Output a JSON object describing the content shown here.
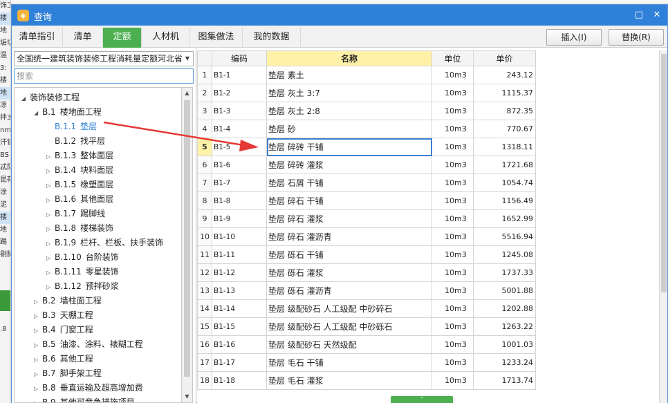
{
  "background_app": {
    "left_fragments": [
      "饰工",
      "楼",
      "地",
      "垢切",
      "混",
      "3:",
      "楼",
      "地",
      "凉",
      "拌3",
      "nm,",
      "汗铺",
      "BS",
      "忒防",
      "昆荷",
      "涂",
      "泥",
      "楼",
      "地",
      "踢",
      "剔脚",
      "",
      "",
      "",
      "工",
      "",
      ".8"
    ]
  },
  "dialog": {
    "title": "查询",
    "icon_glyph": "◈",
    "controls": {
      "maximize": "□",
      "close": "✕"
    }
  },
  "tabs": [
    {
      "label": "清单指引",
      "active": false
    },
    {
      "label": "清单",
      "active": false
    },
    {
      "label": "定额",
      "active": true
    },
    {
      "label": "人材机",
      "active": false
    },
    {
      "label": "图集做法",
      "active": false
    },
    {
      "label": "我的数据",
      "active": false
    }
  ],
  "toolbar": {
    "insert_label": "插入(I)",
    "replace_label": "替换(R)"
  },
  "left": {
    "quota_library": "全国统一建筑装饰装修工程消耗量定额河北省",
    "search_placeholder": "搜索",
    "tree": [
      {
        "tri": "◢",
        "code": "",
        "label": "装饰装修工程",
        "level": 0,
        "selected": false
      },
      {
        "tri": "◢",
        "code": "B.1",
        "label": "楼地面工程",
        "level": 1,
        "selected": false
      },
      {
        "tri": "",
        "code": "B.1.1",
        "label": "垫层",
        "level": 2,
        "selected": true
      },
      {
        "tri": "",
        "code": "B.1.2",
        "label": "找平层",
        "level": 2,
        "selected": false
      },
      {
        "tri": "▷",
        "code": "B.1.3",
        "label": "整体面层",
        "level": 2,
        "selected": false
      },
      {
        "tri": "▷",
        "code": "B.1.4",
        "label": "块料面层",
        "level": 2,
        "selected": false
      },
      {
        "tri": "▷",
        "code": "B.1.5",
        "label": "橡塑面层",
        "level": 2,
        "selected": false
      },
      {
        "tri": "▷",
        "code": "B.1.6",
        "label": "其他面层",
        "level": 2,
        "selected": false
      },
      {
        "tri": "▷",
        "code": "B.1.7",
        "label": "踢脚线",
        "level": 2,
        "selected": false
      },
      {
        "tri": "▷",
        "code": "B.1.8",
        "label": "楼梯装饰",
        "level": 2,
        "selected": false
      },
      {
        "tri": "▷",
        "code": "B.1.9",
        "label": "栏杆、栏板、扶手装饰",
        "level": 2,
        "selected": false
      },
      {
        "tri": "▷",
        "code": "B.1.10",
        "label": "台阶装饰",
        "level": 2,
        "selected": false
      },
      {
        "tri": "▷",
        "code": "B.1.11",
        "label": "零星装饰",
        "level": 2,
        "selected": false
      },
      {
        "tri": "▷",
        "code": "B.1.12",
        "label": "预拌砂浆",
        "level": 2,
        "selected": false
      },
      {
        "tri": "▷",
        "code": "B.2",
        "label": "墙柱面工程",
        "level": 1,
        "selected": false
      },
      {
        "tri": "▷",
        "code": "B.3",
        "label": "天棚工程",
        "level": 1,
        "selected": false
      },
      {
        "tri": "▷",
        "code": "B.4",
        "label": "门窗工程",
        "level": 1,
        "selected": false
      },
      {
        "tri": "▷",
        "code": "B.5",
        "label": "油漆、涂料、裱糊工程",
        "level": 1,
        "selected": false
      },
      {
        "tri": "▷",
        "code": "B.6",
        "label": "其他工程",
        "level": 1,
        "selected": false
      },
      {
        "tri": "▷",
        "code": "B.7",
        "label": "脚手架工程",
        "level": 1,
        "selected": false
      },
      {
        "tri": "▷",
        "code": "B.8",
        "label": "垂直运输及超高增加费",
        "level": 1,
        "selected": false
      },
      {
        "tri": "▷",
        "code": "B.9",
        "label": "其他可竞争措施项目",
        "level": 1,
        "selected": false
      }
    ]
  },
  "grid": {
    "columns": [
      "",
      "编码",
      "名称",
      "单位",
      "单价"
    ],
    "current_row": 5,
    "rows": [
      {
        "no": "1",
        "code": "B1-1",
        "name": "垫层 素土",
        "unit": "10m3",
        "price": "243.12"
      },
      {
        "no": "2",
        "code": "B1-2",
        "name": "垫层 灰土 3:7",
        "unit": "10m3",
        "price": "1115.37"
      },
      {
        "no": "3",
        "code": "B1-3",
        "name": "垫层 灰土 2:8",
        "unit": "10m3",
        "price": "872.35"
      },
      {
        "no": "4",
        "code": "B1-4",
        "name": "垫层 砂",
        "unit": "10m3",
        "price": "770.67"
      },
      {
        "no": "5",
        "code": "B1-5",
        "name": "垫层 碎砖 干铺",
        "unit": "10m3",
        "price": "1318.11"
      },
      {
        "no": "6",
        "code": "B1-6",
        "name": "垫层 碎砖 灌浆",
        "unit": "10m3",
        "price": "1721.68"
      },
      {
        "no": "7",
        "code": "B1-7",
        "name": "垫层 石屑 干铺",
        "unit": "10m3",
        "price": "1054.74"
      },
      {
        "no": "8",
        "code": "B1-8",
        "name": "垫层 碎石 干铺",
        "unit": "10m3",
        "price": "1156.49"
      },
      {
        "no": "9",
        "code": "B1-9",
        "name": "垫层 碎石 灌浆",
        "unit": "10m3",
        "price": "1652.99"
      },
      {
        "no": "10",
        "code": "B1-10",
        "name": "垫层 碎石 灌沥青",
        "unit": "10m3",
        "price": "5516.94"
      },
      {
        "no": "11",
        "code": "B1-11",
        "name": "垫层 砾石 干铺",
        "unit": "10m3",
        "price": "1245.08"
      },
      {
        "no": "12",
        "code": "B1-12",
        "name": "垫层 砾石 灌浆",
        "unit": "10m3",
        "price": "1737.33"
      },
      {
        "no": "13",
        "code": "B1-13",
        "name": "垫层 砾石 灌沥青",
        "unit": "10m3",
        "price": "5001.88"
      },
      {
        "no": "14",
        "code": "B1-14",
        "name": "垫层 级配砂石 人工级配 中砂碎石",
        "unit": "10m3",
        "price": "1202.88"
      },
      {
        "no": "15",
        "code": "B1-15",
        "name": "垫层 级配砂石 人工级配 中砂砾石",
        "unit": "10m3",
        "price": "1263.22"
      },
      {
        "no": "16",
        "code": "B1-16",
        "name": "垫层 级配砂石 天然级配",
        "unit": "10m3",
        "price": "1001.03"
      },
      {
        "no": "17",
        "code": "B1-17",
        "name": "垫层 毛石 干铺",
        "unit": "10m3",
        "price": "1233.24"
      },
      {
        "no": "18",
        "code": "B1-18",
        "name": "垫层 毛石 灌浆",
        "unit": "10m3",
        "price": "1713.74"
      }
    ]
  },
  "colors": {
    "titlebar": "#2f80d8",
    "active_tab": "#4caf50",
    "header_highlight": "#fff2a8",
    "annotation_arrow": "#e53935"
  }
}
